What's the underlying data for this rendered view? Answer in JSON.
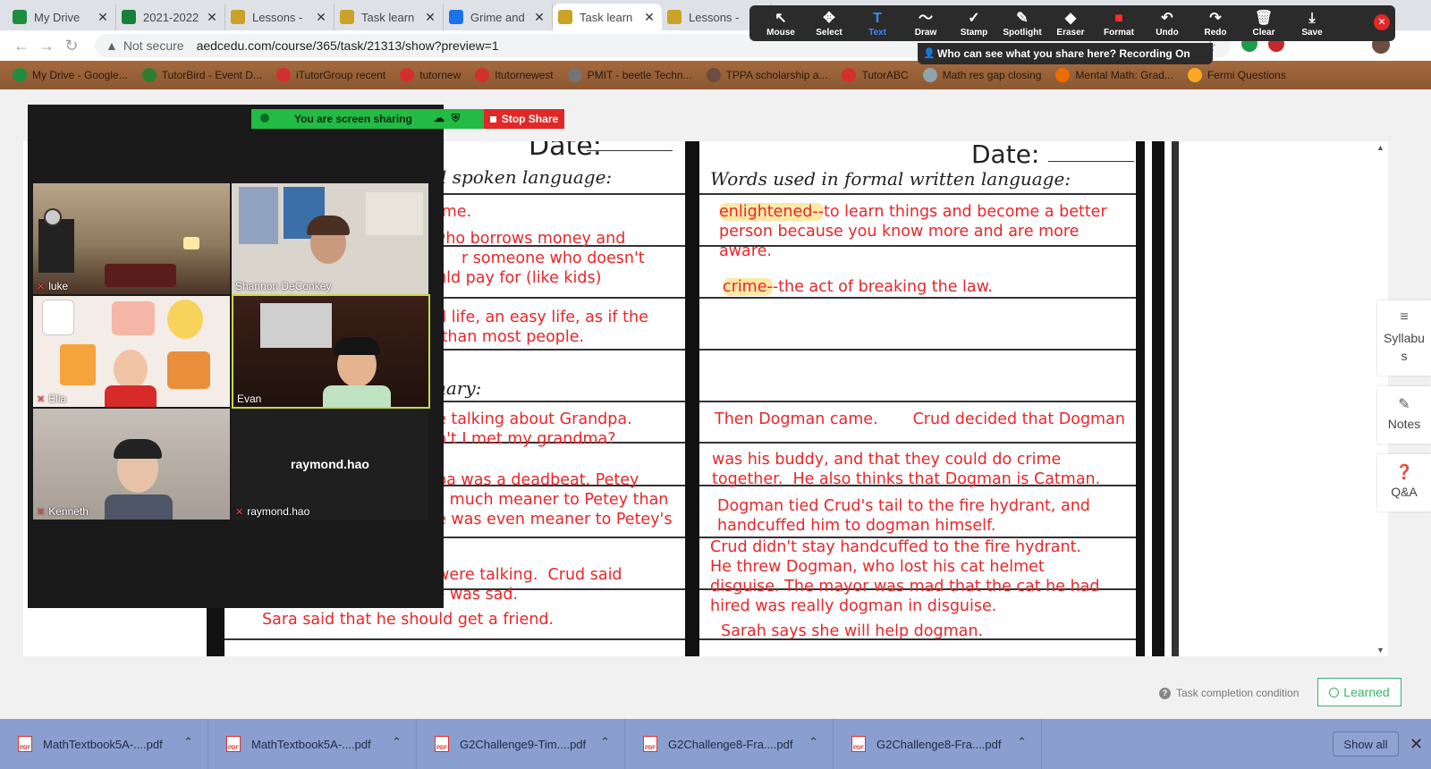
{
  "browser": {
    "tabs": [
      {
        "label": "My Drive",
        "favicon": "drive-icon",
        "color": "#1e8e3e",
        "active": false
      },
      {
        "label": "2021-2022",
        "favicon": "sheets-icon",
        "color": "#188038",
        "active": false
      },
      {
        "label": "Lessons - ",
        "favicon": "lesson-icon",
        "color": "#c9a227",
        "active": false
      },
      {
        "label": "Task learn",
        "favicon": "lesson-icon",
        "color": "#c9a227",
        "active": false
      },
      {
        "label": "Grime and",
        "favicon": "cloud-icon",
        "color": "#1a73e8",
        "active": false
      },
      {
        "label": "Task learn",
        "favicon": "lesson-icon",
        "color": "#c9a227",
        "active": true
      },
      {
        "label": "Lessons - ",
        "favicon": "lesson-icon",
        "color": "#c9a227",
        "active": false
      }
    ],
    "security": "Not secure",
    "url": "aedcedu.com/course/365/task/21313/show?preview=1",
    "bookmarks": [
      {
        "label": "My Drive - Google...",
        "color": "#1e8e3e"
      },
      {
        "label": "TutorBird - Event D...",
        "color": "#2e7d32"
      },
      {
        "label": "iTutorGroup recent",
        "color": "#d32f2f"
      },
      {
        "label": "tutornew",
        "color": "#d32f2f"
      },
      {
        "label": "Itutornewest",
        "color": "#d32f2f"
      },
      {
        "label": "PMIT - beetle Techn...",
        "color": "#757575"
      },
      {
        "label": "TPPA scholarship a...",
        "color": "#6d4c41"
      },
      {
        "label": "TutorABC",
        "color": "#d32f2f"
      },
      {
        "label": "Math res gap closing",
        "color": "#90a4ae"
      },
      {
        "label": "Mental Math: Grad...",
        "color": "#ef6c00"
      },
      {
        "label": "Fermi Questions",
        "color": "#f9a825"
      }
    ]
  },
  "annotation_toolbar": {
    "tools": [
      {
        "label": "Mouse",
        "icon": "cursor-icon",
        "glyph": "↖"
      },
      {
        "label": "Select",
        "icon": "move-icon",
        "glyph": "✥"
      },
      {
        "label": "Text",
        "icon": "text-icon",
        "glyph": "T",
        "selected": true
      },
      {
        "label": "Draw",
        "icon": "squiggle-icon",
        "glyph": "〜"
      },
      {
        "label": "Stamp",
        "icon": "check-icon",
        "glyph": "✓"
      },
      {
        "label": "Spotlight",
        "icon": "wand-icon",
        "glyph": "✎"
      },
      {
        "label": "Eraser",
        "icon": "eraser-icon",
        "glyph": "◆"
      },
      {
        "label": "Format",
        "icon": "format-icon",
        "glyph": "■"
      },
      {
        "label": "Undo",
        "icon": "undo-icon",
        "glyph": "↶"
      },
      {
        "label": "Redo",
        "icon": "redo-icon",
        "glyph": "↷"
      },
      {
        "label": "Clear",
        "icon": "trash-icon",
        "glyph": "🗑"
      },
      {
        "label": "Save",
        "icon": "save-icon",
        "glyph": "⤓"
      }
    ],
    "notice": "Who can see what you share here? Recording On"
  },
  "zoom": {
    "sharing_label": "You are screen sharing",
    "stop_share_label": "Stop Share",
    "participants": [
      {
        "name": "luke"
      },
      {
        "name": "Shannon DeConkey"
      },
      {
        "name": "Ella"
      },
      {
        "name": "Evan"
      },
      {
        "name": "Kenneth"
      },
      {
        "name": "raymond.hao"
      }
    ],
    "raymond_center": "raymond.hao"
  },
  "worksheet": {
    "left_date": "Date:",
    "left_heading": "al spoken language:",
    "right_date": "Date:",
    "right_heading": "Words used in formal written language:",
    "summary_heading": "nary:",
    "left_lines": [
      "lime.",
      "who borrows money and",
      "r someone who doesn't",
      "uld pay for (like kids)",
      "d life, an easy life, as if the",
      " than most people.",
      "e talking about Grandpa.",
      "n't I met my grandma?",
      "pa was a deadbeat. Petey",
      "s much meaner to Petey than",
      "e was even meaner to Petey's",
      "were talking.  Crud said",
      "he was sad because he was sad.",
      "Sara said that he should get a friend."
    ],
    "right_vocab": [
      {
        "word": "enlightened--",
        "definition": "to learn things and become a better\nperson because you know more and are more\naware."
      },
      {
        "word": "crime-",
        "definition": "-the act of breaking the law."
      }
    ],
    "right_lines": [
      "Then Dogman came.       Crud decided that Dogman",
      "was his buddy, and that they could do crime\ntogether.  He also thinks that Dogman is Catman.",
      "Dogman tied Crud's tail to the fire hydrant, and\nhandcuffed him to dogman himself.",
      "Crud didn't stay handcuffed to the fire hydrant.\nHe threw Dogman, who lost his cat helmet\ndisguise. The mayor was mad that the cat he had\nhired was really dogman in disguise.",
      "Sarah says she will help dogman."
    ]
  },
  "sidebar": {
    "syllabus": "Syllabus",
    "notes": "Notes",
    "qa": "Q&A"
  },
  "task": {
    "completion_label": "Task completion condition",
    "learned_label": "Learned"
  },
  "downloads": {
    "files": [
      "MathTextbook5A-....pdf",
      "MathTextbook5A-....pdf",
      "G2Challenge9-Tim....pdf",
      "G2Challenge8-Fra....pdf",
      "G2Challenge8-Fra....pdf"
    ],
    "show_all": "Show all"
  }
}
